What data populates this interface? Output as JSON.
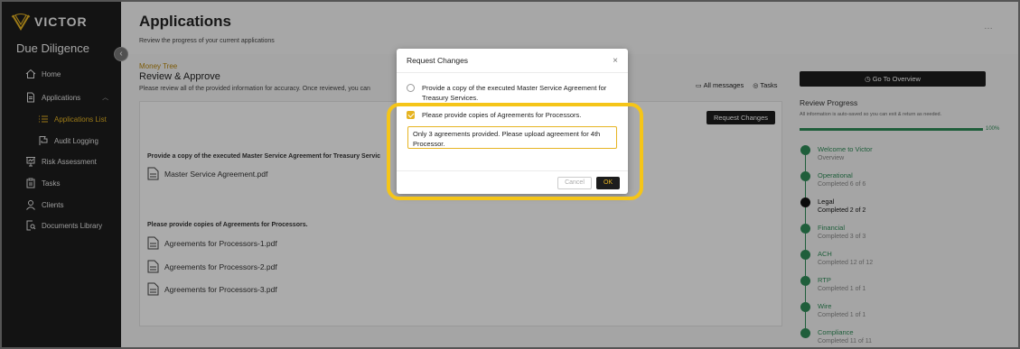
{
  "brand": {
    "name": "VICTOR"
  },
  "sidebar": {
    "module_title": "Due Diligence",
    "collapse_icon": "chevron-left-icon",
    "items": [
      {
        "label": "Home",
        "icon": "home-icon"
      },
      {
        "label": "Applications",
        "icon": "document-icon",
        "expanded": true
      },
      {
        "label": "Applications List",
        "icon": "list-icon",
        "active": true
      },
      {
        "label": "Audit Logging",
        "icon": "flag-icon"
      },
      {
        "label": "Risk Assessment",
        "icon": "presentation-icon"
      },
      {
        "label": "Tasks",
        "icon": "clipboard-icon"
      },
      {
        "label": "Clients",
        "icon": "user-icon"
      },
      {
        "label": "Documents Library",
        "icon": "search-document-icon"
      }
    ]
  },
  "header": {
    "title": "Applications",
    "subtitle": "Review the progress of your current applications"
  },
  "main": {
    "company": "Money Tree",
    "section_title": "Review & Approve",
    "section_sub": "Please review all of the provided information for accuracy. Once reviewed, you can",
    "links": {
      "messages": "All messages",
      "tasks": "Tasks"
    },
    "request_changes_button": "Request Changes",
    "doc_groups": [
      {
        "heading": "Provide a copy of the executed Master Service Agreement for Treasury Servic",
        "files": [
          "Master Service Agreement.pdf"
        ]
      },
      {
        "heading": "Please provide copies of Agreements for Processors.",
        "files": [
          "Agreements for Processors-1.pdf",
          "Agreements for Processors-2.pdf",
          "Agreements for Processors-3.pdf"
        ]
      }
    ]
  },
  "right_panel": {
    "overview_button": "Go To Overview",
    "title": "Review Progress",
    "sub": "All information is auto-saved so you can exit & return as needed.",
    "progress_percent": 100,
    "progress_label": "100%",
    "steps": [
      {
        "title": "Welcome to Victor",
        "sub": "Overview",
        "current": false
      },
      {
        "title": "Operational",
        "sub": "Completed 6 of 6",
        "current": false
      },
      {
        "title": "Legal",
        "sub": "Completed 2 of 2",
        "current": true
      },
      {
        "title": "Financial",
        "sub": "Completed 3 of 3",
        "current": false
      },
      {
        "title": "ACH",
        "sub": "Completed 12 of 12",
        "current": false
      },
      {
        "title": "RTP",
        "sub": "Completed 1 of 1",
        "current": false
      },
      {
        "title": "Wire",
        "sub": "Completed 1 of 1",
        "current": false
      },
      {
        "title": "Compliance",
        "sub": "Completed 11 of 11",
        "current": false
      }
    ]
  },
  "modal": {
    "title": "Request Changes",
    "options": [
      {
        "label": "Provide a copy of the executed Master Service Agreement for Treasury Services.",
        "checked": false
      },
      {
        "label": "Please provide copies of Agreements for Processors.",
        "checked": true
      }
    ],
    "comment": "Only 3 agreements provided. Please upload agreement for 4th Processor.",
    "cancel_label": "Cancel",
    "ok_label": "OK"
  },
  "colors": {
    "accent": "#e6b422",
    "success": "#2e8b57",
    "dark": "#1d1d1d",
    "highlight": "#f5c518"
  }
}
